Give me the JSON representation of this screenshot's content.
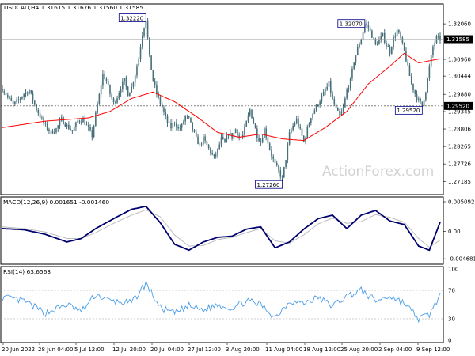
{
  "window": {
    "symbol_info": "USDCAD,H4  1.31615 1.31676 1.31560 1.31585",
    "watermark": "ActionForex.com"
  },
  "colors": {
    "price_bars": "#48707a",
    "moving_average": "#ff0000",
    "macd_line": "#00006e",
    "macd_signal": "#bdbdbd",
    "rsi_line": "#4a9de8",
    "level_line": "#999999",
    "pane_border": "#000000"
  },
  "chart_data": [
    {
      "type": "candlestick",
      "pane": "price",
      "ylim": [
        1.268,
        1.3265
      ],
      "y_ticks": [
        "1.32060",
        "1.31585",
        "1.30960",
        "1.30444",
        "1.29880",
        "1.29345",
        "1.28806",
        "1.28265",
        "1.27726",
        "1.27185"
      ],
      "x_ticks": [
        "20 Jun 2022",
        "28 Jun 04:00",
        "5 Jul 12:00",
        "12 Jul 20:00",
        "20 Jul 04:00",
        "27 Jul 12:00",
        "3 Aug 20:00",
        "11 Aug 04:00",
        "18 Aug 12:00",
        "25 Aug 20:00",
        "2 Sep 04:00",
        "9 Sep 12:00"
      ],
      "current_price": "1.31585",
      "level_price": "1.29520",
      "current_price_value": 1.31585,
      "level_price_value": 1.2952,
      "annotations": [
        {
          "label": "1.32220",
          "value": 1.3222
        },
        {
          "label": "1.27260",
          "value": 1.2726
        },
        {
          "label": "1.32070",
          "value": 1.3207
        },
        {
          "label": "1.29520",
          "value": 1.2952
        }
      ],
      "price_path": [
        [
          0,
          1.3005
        ],
        [
          3,
          1.298
        ],
        [
          6,
          1.2955
        ],
        [
          9,
          1.297
        ],
        [
          12,
          1.299
        ],
        [
          15,
          1.3
        ],
        [
          18,
          1.2955
        ],
        [
          21,
          1.292
        ],
        [
          24,
          1.289
        ],
        [
          27,
          1.287
        ],
        [
          30,
          1.288
        ],
        [
          33,
          1.291
        ],
        [
          36,
          1.289
        ],
        [
          39,
          1.2875
        ],
        [
          42,
          1.2905
        ],
        [
          45,
          1.291
        ],
        [
          48,
          1.288
        ],
        [
          50,
          1.286
        ],
        [
          52,
          1.2925
        ],
        [
          54,
          1.2985
        ],
        [
          56,
          1.305
        ],
        [
          58,
          1.303
        ],
        [
          60,
          1.299
        ],
        [
          62,
          1.296
        ],
        [
          64,
          1.298
        ],
        [
          66,
          1.301
        ],
        [
          68,
          1.303
        ],
        [
          70,
          1.299
        ],
        [
          72,
          1.301
        ],
        [
          74,
          1.305
        ],
        [
          76,
          1.31
        ],
        [
          78,
          1.3175
        ],
        [
          80,
          1.3222
        ],
        [
          82,
          1.31
        ],
        [
          84,
          1.303
        ],
        [
          86,
          1.299
        ],
        [
          88,
          1.296
        ],
        [
          90,
          1.293
        ],
        [
          92,
          1.29
        ],
        [
          94,
          1.2885
        ],
        [
          96,
          1.2905
        ],
        [
          98,
          1.288
        ],
        [
          100,
          1.289
        ],
        [
          102,
          1.292
        ],
        [
          104,
          1.291
        ],
        [
          106,
          1.288
        ],
        [
          108,
          1.285
        ],
        [
          110,
          1.283
        ],
        [
          112,
          1.285
        ],
        [
          114,
          1.283
        ],
        [
          116,
          1.281
        ],
        [
          118,
          1.279
        ],
        [
          120,
          1.2815
        ],
        [
          122,
          1.285
        ],
        [
          124,
          1.2835
        ],
        [
          126,
          1.287
        ],
        [
          128,
          1.2855
        ],
        [
          130,
          1.288
        ],
        [
          132,
          1.2855
        ],
        [
          134,
          1.286
        ],
        [
          136,
          1.29
        ],
        [
          138,
          1.294
        ],
        [
          140,
          1.29
        ],
        [
          142,
          1.286
        ],
        [
          144,
          1.284
        ],
        [
          146,
          1.288
        ],
        [
          148,
          1.284
        ],
        [
          150,
          1.28
        ],
        [
          152,
          1.277
        ],
        [
          154,
          1.275
        ],
        [
          156,
          1.2726
        ],
        [
          158,
          1.279
        ],
        [
          160,
          1.2865
        ],
        [
          162,
          1.289
        ],
        [
          164,
          1.291
        ],
        [
          166,
          1.2875
        ],
        [
          168,
          1.284
        ],
        [
          170,
          1.288
        ],
        [
          172,
          1.292
        ],
        [
          174,
          1.294
        ],
        [
          176,
          1.296
        ],
        [
          178,
          1.298
        ],
        [
          180,
          1.3
        ],
        [
          182,
          1.302
        ],
        [
          184,
          1.297
        ],
        [
          186,
          1.294
        ],
        [
          188,
          1.292
        ],
        [
          190,
          1.2945
        ],
        [
          192,
          1.3
        ],
        [
          194,
          1.303
        ],
        [
          196,
          1.309
        ],
        [
          198,
          1.313
        ],
        [
          200,
          1.316
        ],
        [
          202,
          1.3207
        ],
        [
          204,
          1.3195
        ],
        [
          206,
          1.317
        ],
        [
          208,
          1.314
        ],
        [
          210,
          1.3155
        ],
        [
          212,
          1.317
        ],
        [
          214,
          1.314
        ],
        [
          216,
          1.312
        ],
        [
          218,
          1.316
        ],
        [
          220,
          1.3185
        ],
        [
          222,
          1.316
        ],
        [
          224,
          1.312
        ],
        [
          226,
          1.307
        ],
        [
          228,
          1.302
        ],
        [
          230,
          1.299
        ],
        [
          232,
          1.2968
        ],
        [
          234,
          1.2952
        ],
        [
          236,
          1.3
        ],
        [
          238,
          1.307
        ],
        [
          240,
          1.3135
        ],
        [
          242,
          1.3162
        ],
        [
          244,
          1.3158
        ]
      ],
      "moving_average": [
        [
          0,
          1.2885
        ],
        [
          24,
          1.2905
        ],
        [
          48,
          1.2915
        ],
        [
          60,
          1.2935
        ],
        [
          72,
          1.2975
        ],
        [
          84,
          1.2995
        ],
        [
          96,
          1.2965
        ],
        [
          108,
          1.292
        ],
        [
          120,
          1.287
        ],
        [
          132,
          1.2855
        ],
        [
          144,
          1.2865
        ],
        [
          156,
          1.285
        ],
        [
          168,
          1.2845
        ],
        [
          180,
          1.2885
        ],
        [
          192,
          1.2935
        ],
        [
          204,
          1.302
        ],
        [
          216,
          1.3075
        ],
        [
          224,
          1.3115
        ],
        [
          232,
          1.3085
        ],
        [
          244,
          1.3098
        ]
      ]
    },
    {
      "type": "line",
      "pane": "macd",
      "label": "MACD(12,26,9) 0.001651 -0.001460",
      "ylim": [
        -0.0052,
        0.0055
      ],
      "y_ticks": [
        "0.005092",
        "0.00",
        "-0.004681"
      ],
      "series": [
        {
          "role": "macd",
          "points": [
            [
              0,
              0.0005
            ],
            [
              12,
              0.0003
            ],
            [
              24,
              -0.0005
            ],
            [
              36,
              -0.0018
            ],
            [
              44,
              -0.0012
            ],
            [
              52,
              0.0005
            ],
            [
              62,
              0.0022
            ],
            [
              72,
              0.0038
            ],
            [
              80,
              0.0043
            ],
            [
              88,
              0.0015
            ],
            [
              96,
              -0.0022
            ],
            [
              104,
              -0.0032
            ],
            [
              112,
              -0.0018
            ],
            [
              120,
              -0.001
            ],
            [
              128,
              -0.0008
            ],
            [
              136,
              0.0004
            ],
            [
              144,
              0.0008
            ],
            [
              152,
              -0.0028
            ],
            [
              160,
              -0.0018
            ],
            [
              168,
              0.0004
            ],
            [
              176,
              0.0022
            ],
            [
              184,
              0.0028
            ],
            [
              192,
              0.0005
            ],
            [
              200,
              0.0028
            ],
            [
              208,
              0.0036
            ],
            [
              216,
              0.0018
            ],
            [
              224,
              0.0012
            ],
            [
              232,
              -0.0025
            ],
            [
              238,
              -0.0032
            ],
            [
              244,
              0.0016
            ]
          ]
        },
        {
          "role": "signal",
          "points": [
            [
              0,
              0.0008
            ],
            [
              12,
              0.0005
            ],
            [
              24,
              -0.0001
            ],
            [
              36,
              -0.0012
            ],
            [
              44,
              -0.0012
            ],
            [
              52,
              -0.0002
            ],
            [
              62,
              0.0014
            ],
            [
              72,
              0.0028
            ],
            [
              80,
              0.0037
            ],
            [
              88,
              0.0025
            ],
            [
              96,
              -0.0006
            ],
            [
              104,
              -0.0025
            ],
            [
              112,
              -0.0024
            ],
            [
              120,
              -0.0014
            ],
            [
              128,
              -0.001
            ],
            [
              136,
              -0.0002
            ],
            [
              144,
              0.0005
            ],
            [
              152,
              -0.0016
            ],
            [
              160,
              -0.002
            ],
            [
              168,
              -0.0006
            ],
            [
              176,
              0.0013
            ],
            [
              184,
              0.0023
            ],
            [
              192,
              0.0014
            ],
            [
              200,
              0.0017
            ],
            [
              208,
              0.0029
            ],
            [
              216,
              0.0024
            ],
            [
              224,
              0.0016
            ],
            [
              232,
              -0.0012
            ],
            [
              238,
              -0.0027
            ],
            [
              244,
              -0.0015
            ]
          ]
        }
      ]
    },
    {
      "type": "line",
      "pane": "rsi",
      "label": "RSI(14) 63.6563",
      "ylim": [
        0,
        100
      ],
      "y_ticks": [
        "100",
        "70",
        "30",
        "0"
      ],
      "levels": [
        70,
        30
      ],
      "series": [
        {
          "role": "rsi",
          "points": [
            [
              0,
              60
            ],
            [
              12,
              55
            ],
            [
              24,
              38
            ],
            [
              36,
              50
            ],
            [
              44,
              40
            ],
            [
              52,
              64
            ],
            [
              60,
              55
            ],
            [
              72,
              52
            ],
            [
              80,
              80
            ],
            [
              88,
              45
            ],
            [
              96,
              38
            ],
            [
              104,
              48
            ],
            [
              112,
              42
            ],
            [
              120,
              50
            ],
            [
              128,
              45
            ],
            [
              136,
              55
            ],
            [
              144,
              50
            ],
            [
              152,
              32
            ],
            [
              160,
              55
            ],
            [
              168,
              52
            ],
            [
              176,
              60
            ],
            [
              184,
              48
            ],
            [
              192,
              62
            ],
            [
              200,
              70
            ],
            [
              208,
              55
            ],
            [
              216,
              62
            ],
            [
              224,
              52
            ],
            [
              232,
              30
            ],
            [
              238,
              36
            ],
            [
              244,
              64
            ]
          ]
        }
      ]
    }
  ]
}
